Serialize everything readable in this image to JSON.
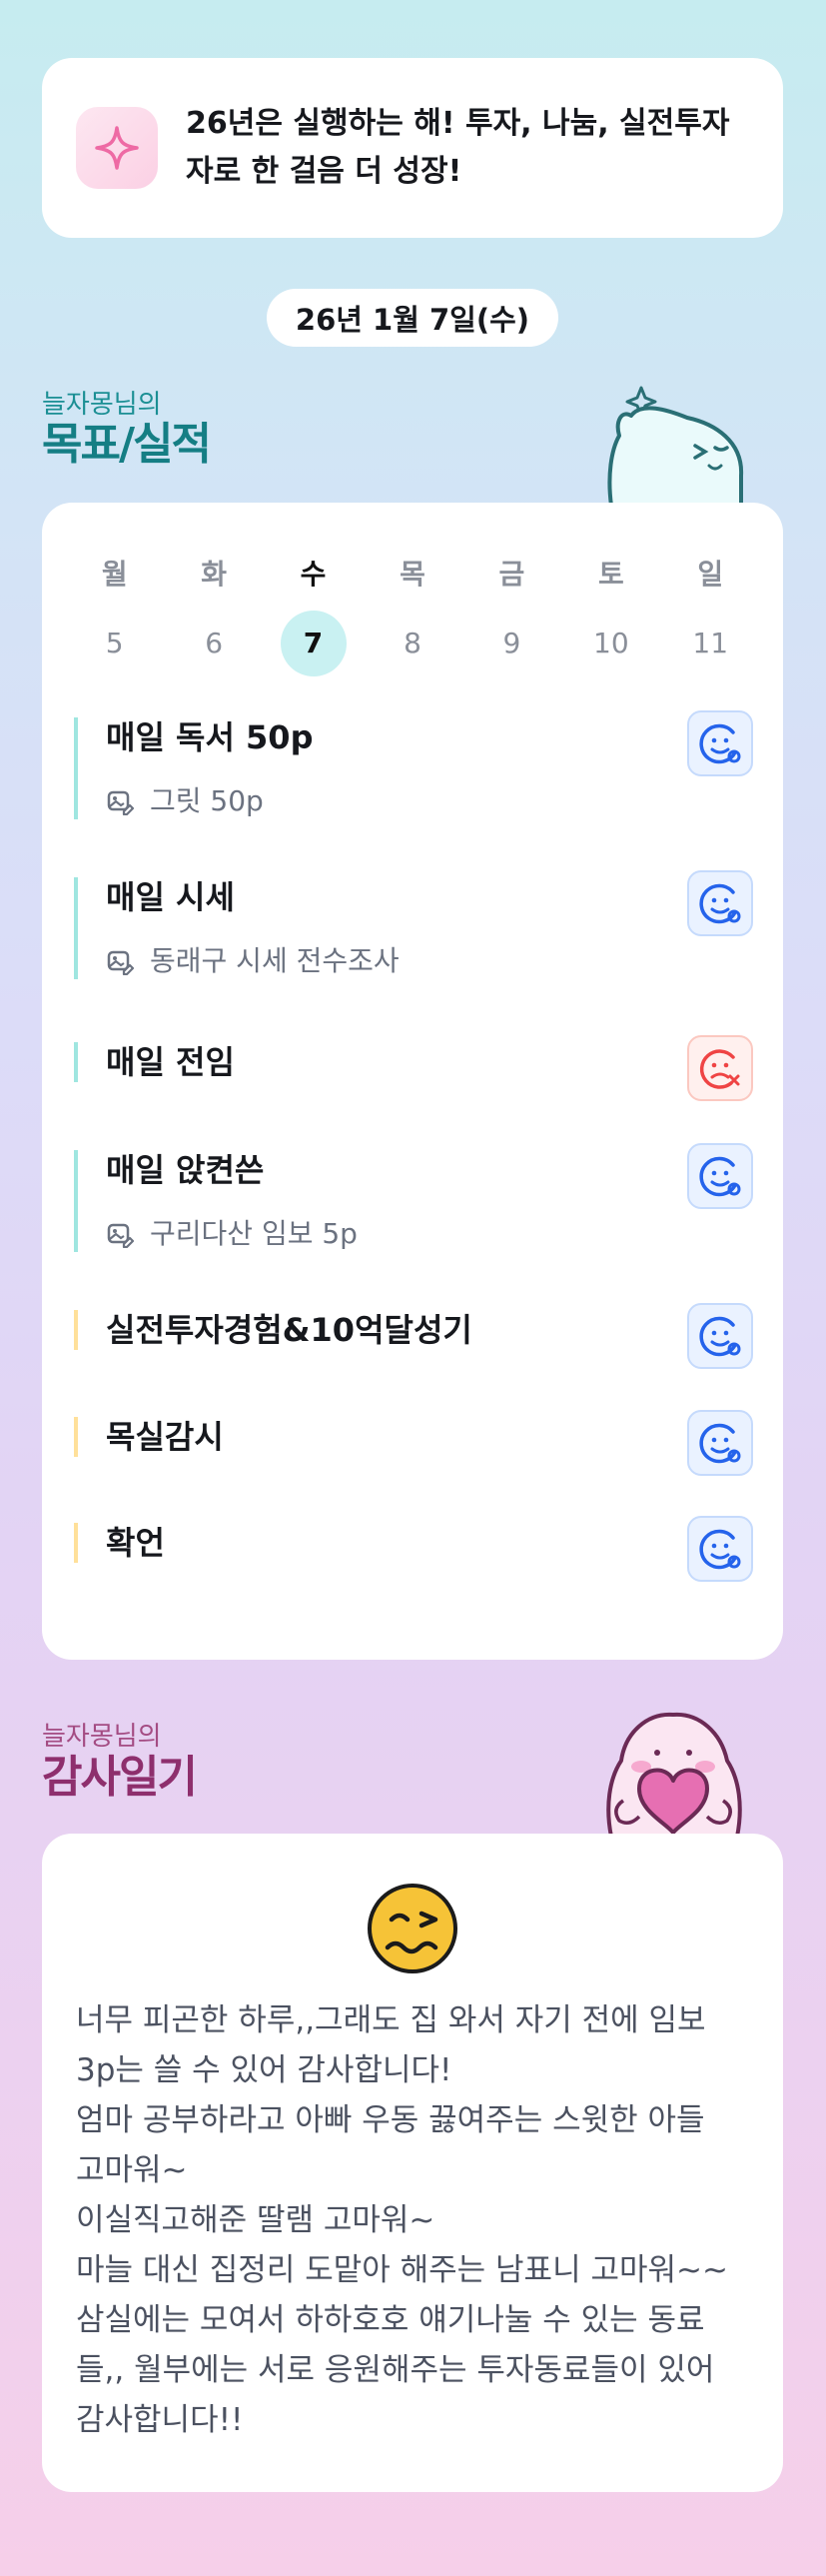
{
  "motto": {
    "icon": "sparkle-icon",
    "text": "26년은 실행하는 해! 투자, 나눔, 실전투자자로 한 걸음 더 성장!"
  },
  "date": "26년 1월 7일(수)",
  "goals_section": {
    "subtitle": "늘자몽님의",
    "title": "목표/실적",
    "week": {
      "days": [
        "월",
        "화",
        "수",
        "목",
        "금",
        "토",
        "일"
      ],
      "dates": [
        "5",
        "6",
        "7",
        "8",
        "9",
        "10",
        "11"
      ],
      "selected_index": 2
    },
    "items": [
      {
        "title": "매일 독서 50p",
        "note": "그릿 50p",
        "status": "done",
        "color": "#9fe6e0"
      },
      {
        "title": "매일 시세",
        "note": "동래구 시세 전수조사",
        "status": "done",
        "color": "#9fe6e0"
      },
      {
        "title": "매일 전임",
        "note": "",
        "status": "missed",
        "color": "#9fe6e0"
      },
      {
        "title": "매일 앉켠쓴",
        "note": "구리다산 임보 5p",
        "status": "done",
        "color": "#9fe6e0"
      },
      {
        "title": "실전투자경험&10억달성기",
        "note": "",
        "status": "done",
        "color": "#ffe09a"
      },
      {
        "title": "목실감시",
        "note": "",
        "status": "done",
        "color": "#ffe09a"
      },
      {
        "title": "확언",
        "note": "",
        "status": "done",
        "color": "#ffe09a"
      }
    ]
  },
  "diary_section": {
    "subtitle": "늘자몽님의",
    "title": "감사일기",
    "mood_icon": "woozy-face-icon",
    "text": "너무 피곤한 하루,,그래도 집 와서 자기 전에 임보\n3p는 쓸 수 있어 감사합니다!\n엄마 공부하라고 아빠 우동 끓여주는 스윗한 아들\n고마워~\n이실직고해준 딸램 고마워~\n마늘 대신 집정리 도맡아 해주는 남표니 고마워~~\n삼실에는 모여서 하하호호 얘기나눌 수 있는 동료\n들,, 월부에는 서로 응원해주는 투자동료들이 있어\n감사합니다!!"
  },
  "colors": {
    "teal_accent": "#157e84",
    "plum_accent": "#8e2f6d",
    "done_blue": "#2563eb",
    "missed_red": "#ef4444"
  }
}
